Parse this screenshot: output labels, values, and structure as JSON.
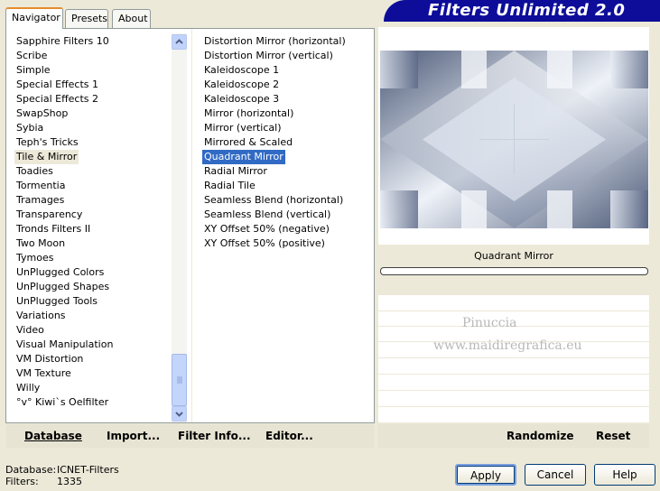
{
  "tabs": [
    "Navigator",
    "Presets",
    "About"
  ],
  "banner": "Filters Unlimited 2.0",
  "categories": [
    "Sapphire Filters 10",
    "Scribe",
    "Simple",
    "Special Effects 1",
    "Special Effects 2",
    "SwapShop",
    "Sybia",
    "Teph's Tricks",
    "Tile & Mirror",
    "Toadies",
    "Tormentia",
    "Tramages",
    "Transparency",
    "Tronds Filters II",
    "Two Moon",
    "Tymoes",
    "UnPlugged Colors",
    "UnPlugged Shapes",
    "UnPlugged Tools",
    "Variations",
    "Video",
    "Visual Manipulation",
    "VM Distortion",
    "VM Texture",
    "Willy",
    "°v° Kiwi`s Oelfilter"
  ],
  "selected_category": "Tile & Mirror",
  "filters": [
    "Distortion Mirror (horizontal)",
    "Distortion Mirror (vertical)",
    "Kaleidoscope 1",
    "Kaleidoscope 2",
    "Kaleidoscope 3",
    "Mirror (horizontal)",
    "Mirror (vertical)",
    "Mirrored & Scaled",
    "Quadrant Mirror",
    "Radial Mirror",
    "Radial Tile",
    "Seamless Blend (horizontal)",
    "Seamless Blend (vertical)",
    "XY Offset 50% (negative)",
    "XY Offset 50% (positive)"
  ],
  "selected_filter": "Quadrant Mirror",
  "toolbar": {
    "database": "Database",
    "import": "Import...",
    "filter_info": "Filter Info...",
    "editor": "Editor...",
    "randomize": "Randomize",
    "reset": "Reset"
  },
  "preview_name": "Quadrant Mirror",
  "watermark": {
    "line1": "Pinuccia",
    "line2": "www.maidiregrafica.eu"
  },
  "status": {
    "database_label": "Database:",
    "database_value": "ICNET-Filters",
    "filters_label": "Filters:",
    "filters_value": "1335"
  },
  "buttons": {
    "apply": "Apply",
    "cancel": "Cancel",
    "help": "Help"
  },
  "colors": {
    "accent": "#316ac5",
    "banner": "#0d0d9a"
  }
}
